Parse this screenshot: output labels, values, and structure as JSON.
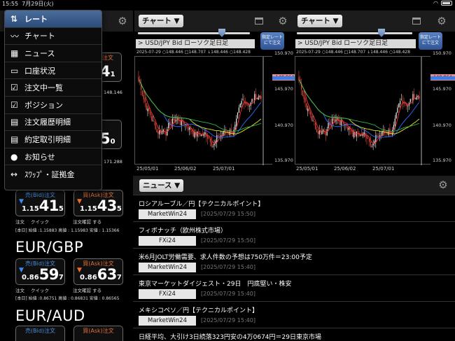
{
  "status_bar": {
    "time": "15:55",
    "date": "7月29日(火)",
    "battery": ""
  },
  "menu": {
    "items": [
      {
        "label": "レート",
        "icon": "sort-arrows-icon"
      },
      {
        "label": "チャート",
        "icon": "line-chart-icon"
      },
      {
        "label": "ニュース",
        "icon": "news-icon"
      },
      {
        "label": "口座状況",
        "icon": "card-icon"
      },
      {
        "label": "注文中一覧",
        "icon": "checkbox-icon"
      },
      {
        "label": "ポジション",
        "icon": "checkbox-icon"
      },
      {
        "label": "注文履歴明細",
        "icon": "list-icon"
      },
      {
        "label": "約定取引明細",
        "icon": "list-icon"
      },
      {
        "label": "お知らせ",
        "icon": "speech-bubble-icon"
      },
      {
        "label": "ｽﾜｯﾌﾟ・証拠金",
        "icon": "swap-arrows-icon"
      }
    ]
  },
  "rates": {
    "partial_top": {
      "ask_label": "注文",
      "big1": "4",
      "sub1": "1",
      "side1": "148.146",
      "big2": "5",
      "sub2": "0",
      "side2": "171.288"
    },
    "pairs": [
      {
        "name": "",
        "bid_label": "売(Bid)注文",
        "ask_label": "買(Ask)注文",
        "bid_small": "1.15",
        "bid_big": "41",
        "bid_sub": "5",
        "ask_small": "1.15",
        "ask_big": "43",
        "ask_sub": "5",
        "labels": [
          "注文",
          "クイック",
          "注文確認",
          "する"
        ],
        "hl": "[本日] 始値 :1.15883  高値 : 1.15983  安値 : 1.15366"
      },
      {
        "name": "EUR/GBP",
        "bid_label": "売(Bid)注文",
        "ask_label": "買(Ask)注文",
        "bid_small": "0.86",
        "bid_big": "59",
        "bid_sub": "7",
        "ask_small": "0.86",
        "ask_big": "63",
        "ask_sub": "7",
        "labels": [
          "注文",
          "クイック",
          "注文確認",
          "する"
        ],
        "hl": "[本日] 始値 :0.86751  高値 : 0.86831  安値 : 0.86565"
      },
      {
        "name": "EUR/AUD",
        "bid_label": "売(Bid)注文",
        "ask_label": "買(Ask)注文"
      }
    ]
  },
  "charts": [
    {
      "select_label": "チャート ▼",
      "order_btn": [
        "指定レート",
        "にて注文"
      ],
      "symbol": "> USD/JPY  Bid  ローソク足日足",
      "ohlc": "2025-07-29   ○148.446   □148.707   ↓148.446   ○148.428",
      "current_price": "148.964"
    },
    {
      "select_label": "チャート ▼",
      "order_btn": [
        "指定レート",
        "にて注文"
      ],
      "symbol": "> USD/JPY  Bid  ローソク足日足",
      "ohlc": "2025-07-29   ○148.446   □148.707   ↓148.446   ○148.428",
      "current_price": "148.964"
    }
  ],
  "chart_data": {
    "type": "candlestick",
    "symbol": "USD/JPY",
    "yticks": [
      "150.970",
      "145.970",
      "140.970",
      "135.970"
    ],
    "xticks": [
      "25/05/01",
      "25/06/02",
      "25/07/01"
    ],
    "ylim": [
      135.97,
      152.0
    ],
    "current_price": 148.964,
    "colors": {
      "up": "#e8e8e8",
      "down": "#e0463a",
      "ma_short": "#ff3030",
      "ma_mid": "#2b6cff",
      "ma_long": "#e8e820",
      "ma_4": "#2fb34a"
    }
  },
  "news": {
    "select_label": "ニュース ▼",
    "items": [
      {
        "title": "ロシアルーブル／円【テクニカルポイント】",
        "source": "MarketWin24",
        "time": "[2025/07/29 15:50]"
      },
      {
        "title": "フィボナッチ（欧州株式市場）",
        "source": "FXi24",
        "time": "[2025/07/29 15:50]"
      },
      {
        "title": "米6月JOLT労働需要、求人件数の予想は750万件＝23:00予定",
        "source": "MarketWin24",
        "time": "[2025/07/29 15:40]"
      },
      {
        "title": "東京マーケットダイジェスト・29日　円底堅い・株安",
        "source": "FXi24",
        "time": "[2025/07/29 15:40]"
      },
      {
        "title": "メキシコペソ／円【テクニカルポイント】",
        "source": "MarketWin24",
        "time": "[2025/07/29 15:40]"
      },
      {
        "title": "日経平均、大引け3日続落323円安の4万0674円＝29日東京市場",
        "source": "",
        "time": ""
      }
    ]
  }
}
